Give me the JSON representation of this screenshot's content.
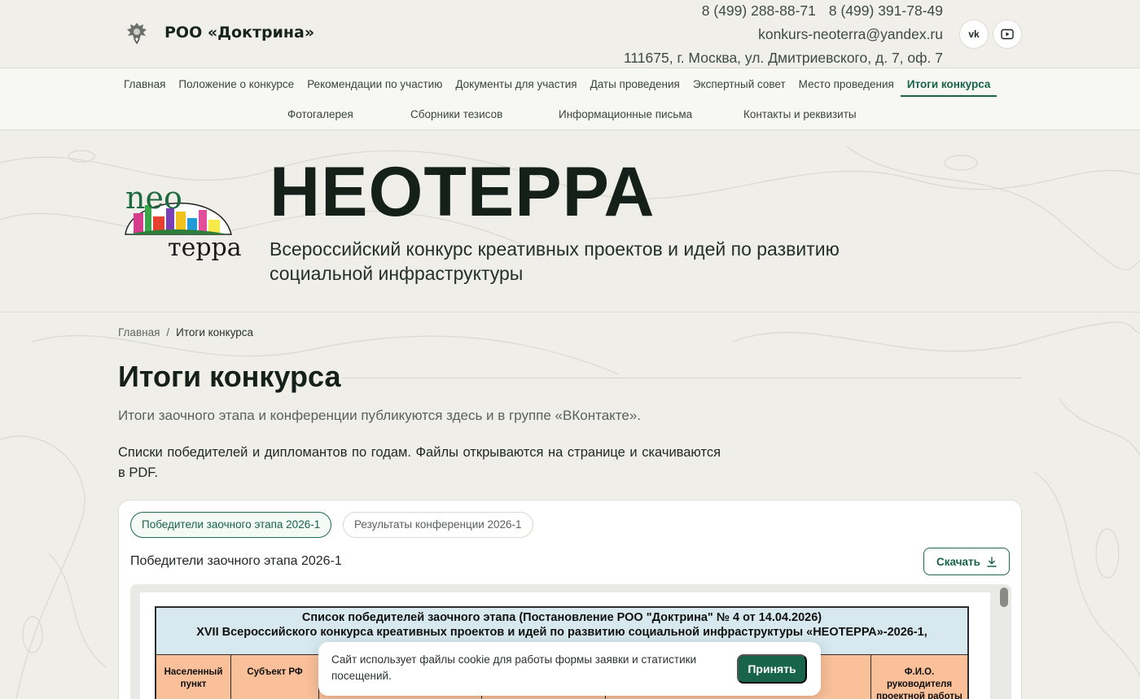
{
  "colors": {
    "accent": "#17644a",
    "header_bg": "#f0efea",
    "page_bg": "#efeee8",
    "table_head": "#d7e9ee",
    "table_cols": "#f9c09a"
  },
  "header": {
    "org_name": "РОО «Доктрина»",
    "emblem_icon": "double-headed-eagle-emblem",
    "phones": [
      "8 (499) 288-88-71",
      "8 (499) 391-78-49"
    ],
    "email": "konkurs-neoterra@yandex.ru",
    "address": "111675, г. Москва, ул. Дмитриевского, д. 7, оф. 7",
    "social": {
      "vk_label": "vk",
      "vk_icon": "vk-icon",
      "youtube_icon": "youtube-icon"
    }
  },
  "nav": {
    "row1": [
      "Главная",
      "Положение о конкурсе",
      "Рекомендации по участию",
      "Документы для участия",
      "Даты проведения",
      "Экспертный совет",
      "Место проведения",
      "Итоги конкурса"
    ],
    "active": "Итоги конкурса",
    "row2": [
      "Фотогалерея",
      "Сборники тезисов",
      "Информационные письма",
      "Контакты и реквизиты"
    ]
  },
  "hero": {
    "logo_text_top": "neo",
    "logo_text_bottom": "терра",
    "title": "НЕОТЕРРА",
    "subtitle": "Всероссийский конкурс креативных проектов и идей по развитию социальной инфраструктуры"
  },
  "breadcrumb": {
    "home": "Главная",
    "separator": "/",
    "current": "Итоги конкурса"
  },
  "main": {
    "title": "Итоги конкурса",
    "lead": "Итоги заочного этапа и конференции публикуются здесь и в группе «ВКонтакте».",
    "description": "Списки победителей и дипломантов по годам. Файлы открываются на странице и скачиваются в PDF."
  },
  "results_card": {
    "tabs": [
      "Победители заочного этапа 2026-1",
      "Результаты конференции 2026-1"
    ],
    "active_tab": 0,
    "document_label": "Победители заочного этапа 2026-1",
    "download_label": "Скачать",
    "download_icon": "download-icon",
    "document": {
      "heading_line1": "Список победителей заочного этапа (Постановление РОО \"Доктрина\" № 4 от 14.04.2026)",
      "heading_line2": "XVII Всероссийского конкурса креативных проектов и идей по развитию социальной инфраструктуры «НЕОТЕРРА»-2026-1,",
      "columns": [
        "Населенный пункт",
        "Субъект РФ",
        "",
        "",
        "",
        "Ф.И.О. руководителя проектной работы"
      ]
    }
  },
  "cookie": {
    "text": "Сайт использует файлы cookie для работы формы заявки и статистики посещений.",
    "accept_label": "Принять"
  }
}
